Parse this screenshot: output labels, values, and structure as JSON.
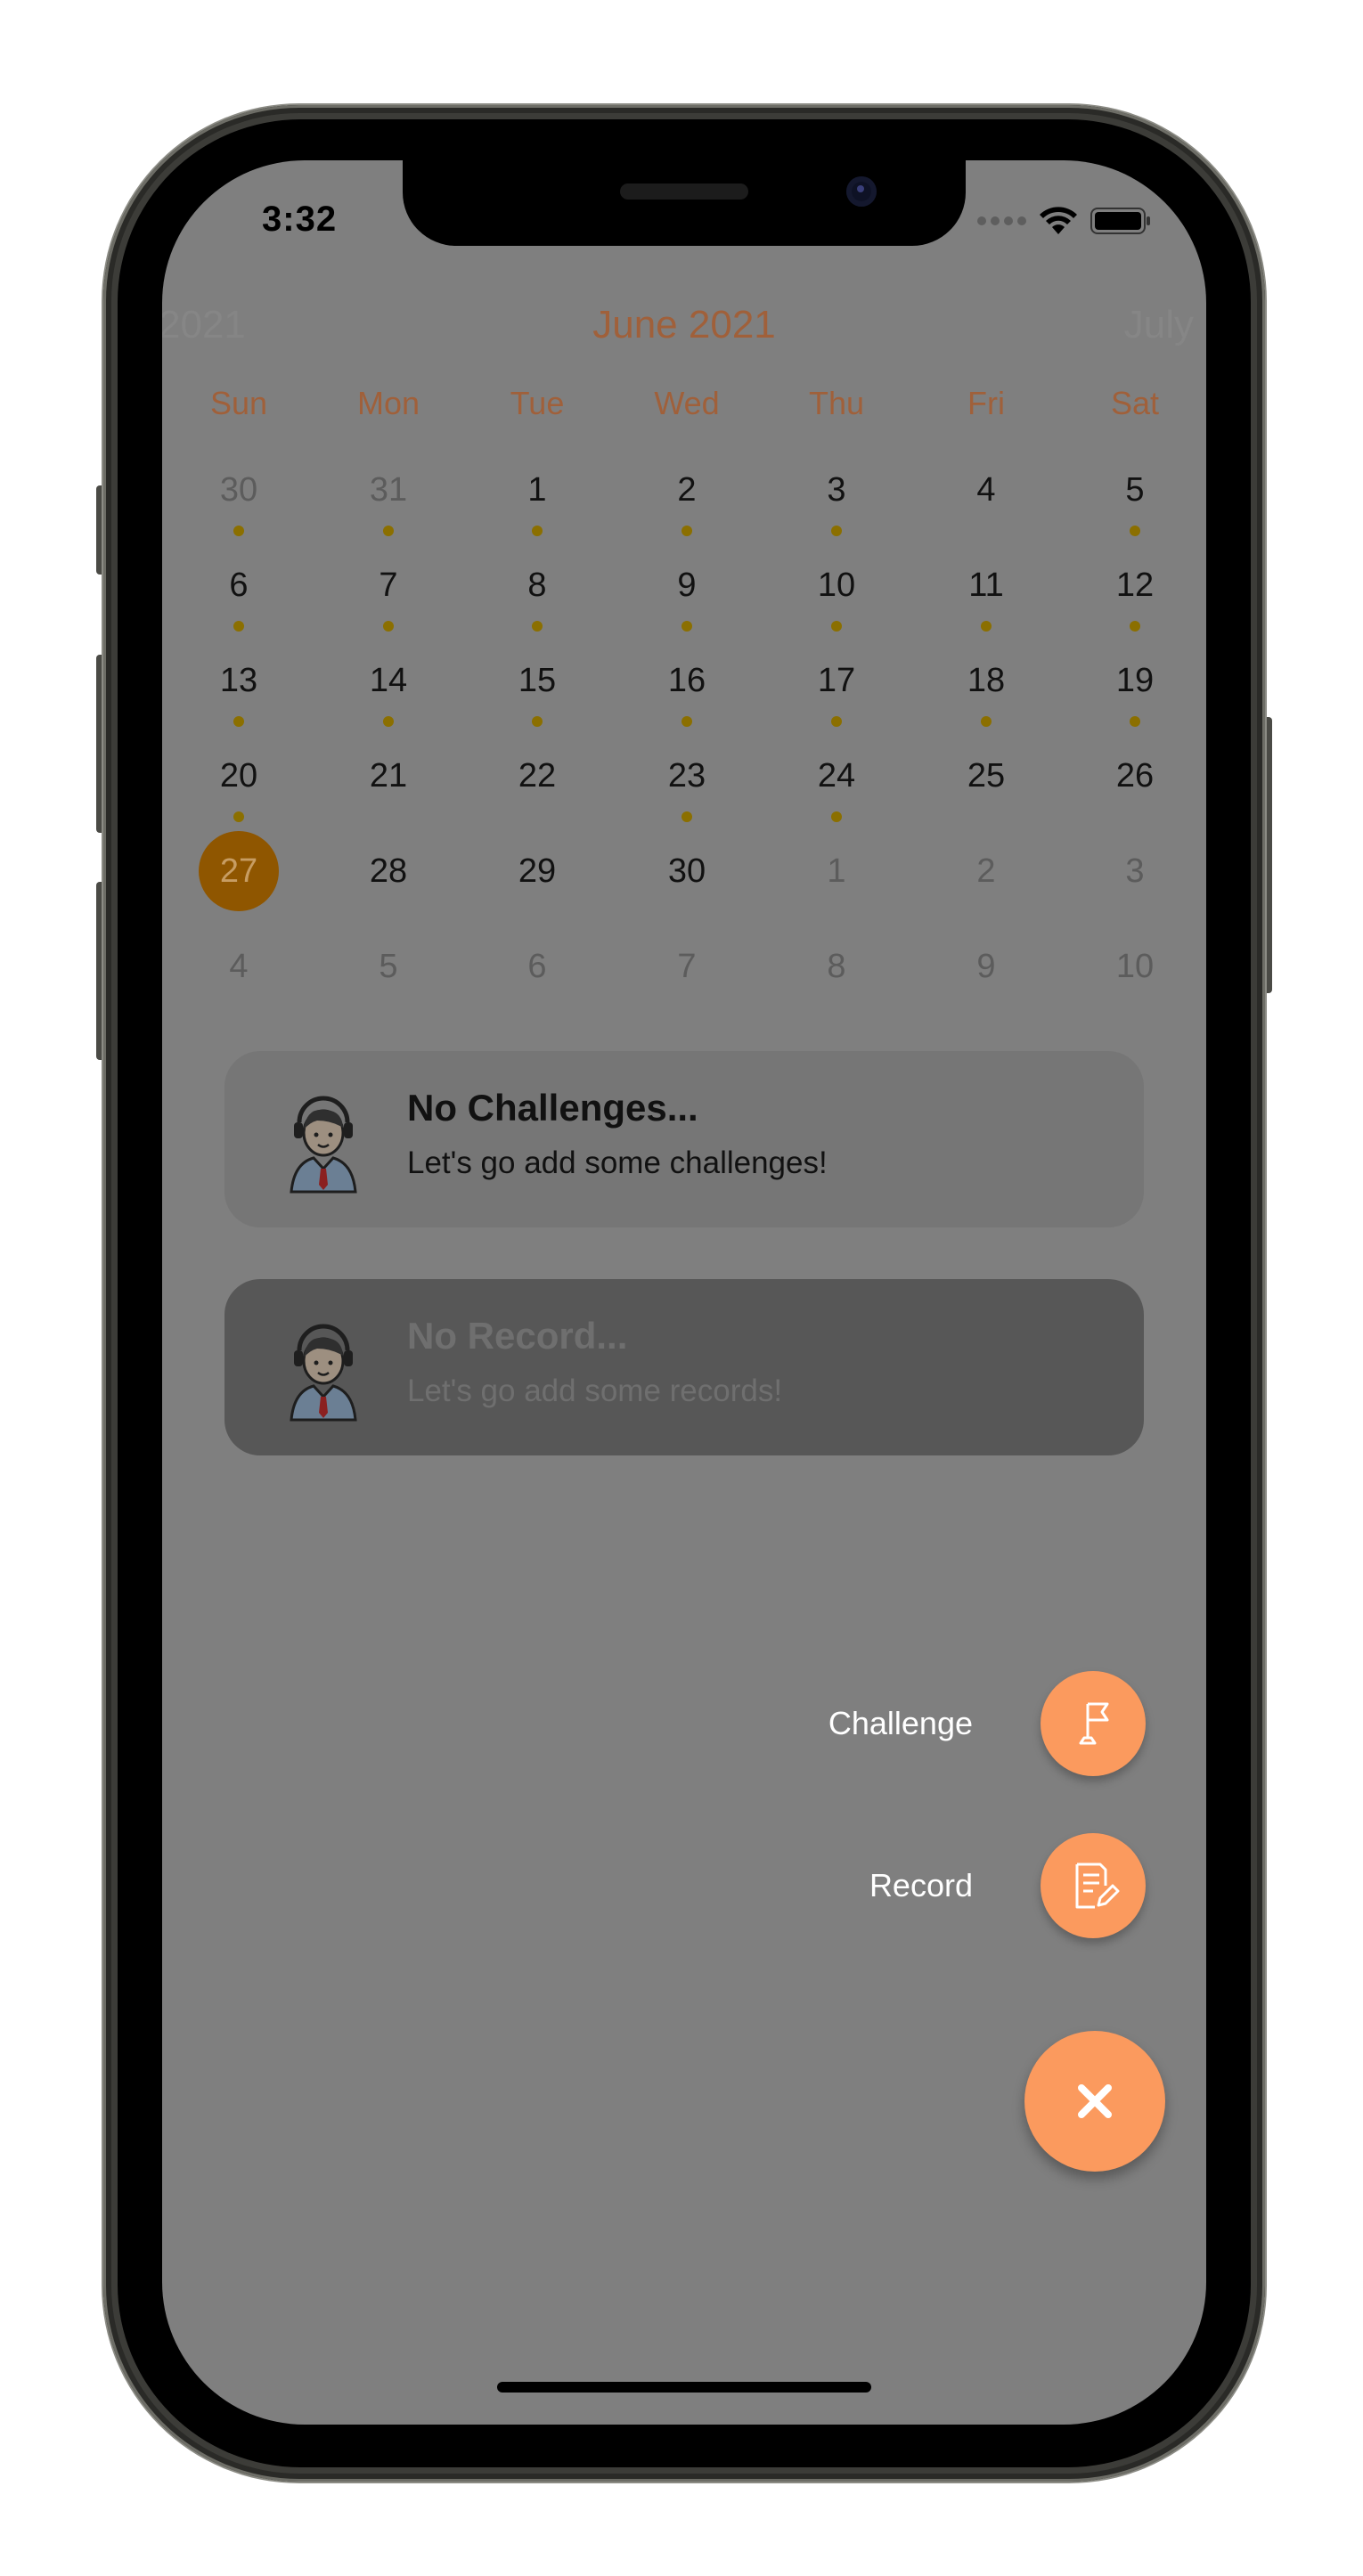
{
  "status_bar": {
    "time": "3:32"
  },
  "calendar": {
    "prev_month": "2021",
    "current_month": "June 2021",
    "next_month": "July",
    "accent_color": "#a0603a",
    "weekdays": [
      "Sun",
      "Mon",
      "Tue",
      "Wed",
      "Thu",
      "Fri",
      "Sat"
    ],
    "weeks": [
      [
        {
          "d": "30",
          "other": true,
          "dot": true
        },
        {
          "d": "31",
          "other": true,
          "dot": true
        },
        {
          "d": "1",
          "dot": true
        },
        {
          "d": "2",
          "dot": true
        },
        {
          "d": "3",
          "dot": true
        },
        {
          "d": "4",
          "dot": false
        },
        {
          "d": "5",
          "dot": true
        }
      ],
      [
        {
          "d": "6",
          "dot": true
        },
        {
          "d": "7",
          "dot": true
        },
        {
          "d": "8",
          "dot": true
        },
        {
          "d": "9",
          "dot": true
        },
        {
          "d": "10",
          "dot": true
        },
        {
          "d": "11",
          "dot": true
        },
        {
          "d": "12",
          "dot": true
        }
      ],
      [
        {
          "d": "13",
          "dot": true
        },
        {
          "d": "14",
          "dot": true
        },
        {
          "d": "15",
          "dot": true
        },
        {
          "d": "16",
          "dot": true
        },
        {
          "d": "17",
          "dot": true
        },
        {
          "d": "18",
          "dot": true
        },
        {
          "d": "19",
          "dot": true
        }
      ],
      [
        {
          "d": "20",
          "dot": true
        },
        {
          "d": "21",
          "dot": false
        },
        {
          "d": "22",
          "dot": false
        },
        {
          "d": "23",
          "dot": true
        },
        {
          "d": "24",
          "dot": true
        },
        {
          "d": "25",
          "dot": false
        },
        {
          "d": "26",
          "dot": false
        }
      ],
      [
        {
          "d": "27",
          "today": true
        },
        {
          "d": "28"
        },
        {
          "d": "29"
        },
        {
          "d": "30"
        },
        {
          "d": "1",
          "other": true
        },
        {
          "d": "2",
          "other": true
        },
        {
          "d": "3",
          "other": true
        }
      ],
      [
        {
          "d": "4",
          "other": true
        },
        {
          "d": "5",
          "other": true
        },
        {
          "d": "6",
          "other": true
        },
        {
          "d": "7",
          "other": true
        },
        {
          "d": "8",
          "other": true
        },
        {
          "d": "9",
          "other": true
        },
        {
          "d": "10",
          "other": true
        }
      ]
    ]
  },
  "challenges_card": {
    "title": "No Challenges...",
    "subtitle": "Let's go add some challenges!"
  },
  "records_card": {
    "title": "No Record...",
    "subtitle": "Let's go add some records!"
  },
  "fab_menu": {
    "challenge_label": "Challenge",
    "record_label": "Record",
    "challenge_icon": "flag-icon",
    "record_icon": "document-edit-icon",
    "close_icon": "close-icon",
    "accent_color": "#fb9a5e"
  }
}
